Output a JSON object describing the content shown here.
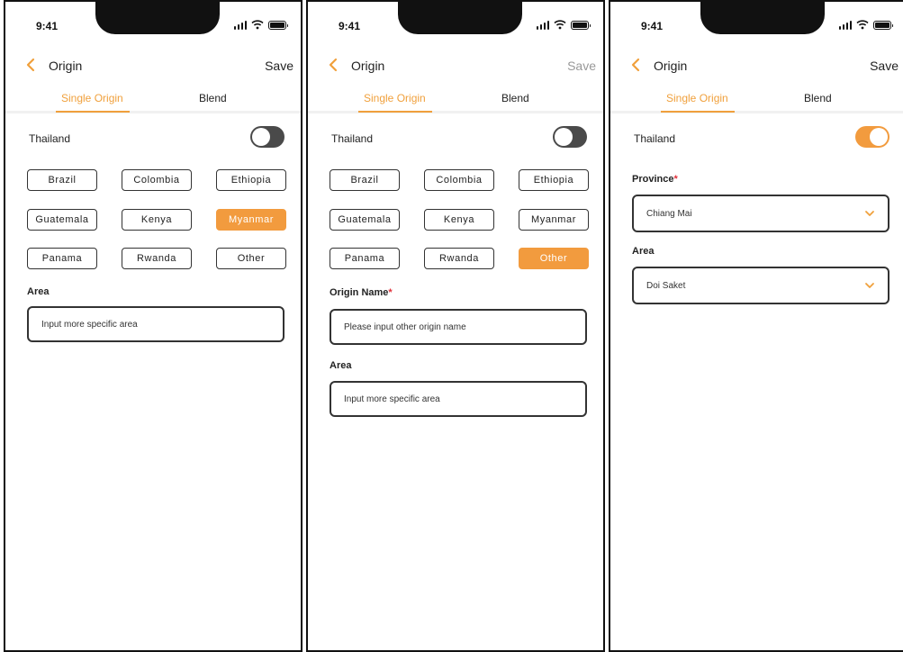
{
  "screens": [
    {
      "status": {
        "time": "9:41"
      },
      "header": {
        "title": "Origin",
        "save_label": "Save"
      },
      "tabs": [
        "Single Origin",
        "Blend"
      ],
      "country_toggle": {
        "label": "Thailand",
        "state": "off"
      },
      "chips": [
        {
          "label": "Brazil",
          "selected": false
        },
        {
          "label": "Colombia",
          "selected": false
        },
        {
          "label": "Ethiopia",
          "selected": false
        },
        {
          "label": "Guatemala",
          "selected": false
        },
        {
          "label": "Kenya",
          "selected": false
        },
        {
          "label": "Myanmar",
          "selected": true
        },
        {
          "label": "Panama",
          "selected": false
        },
        {
          "label": "Rwanda",
          "selected": false
        },
        {
          "label": "Other",
          "selected": false
        }
      ],
      "area": {
        "label": "Area",
        "placeholder": "Input more specific area"
      }
    },
    {
      "status": {
        "time": "9:41"
      },
      "header": {
        "title": "Origin",
        "save_label": "Save",
        "save_state": "disabled"
      },
      "tabs": [
        "Single Origin",
        "Blend"
      ],
      "country_toggle": {
        "label": "Thailand",
        "state": "off"
      },
      "chips": [
        {
          "label": "Brazil",
          "selected": false
        },
        {
          "label": "Colombia",
          "selected": false
        },
        {
          "label": "Ethiopia",
          "selected": false
        },
        {
          "label": "Guatemala",
          "selected": false
        },
        {
          "label": "Kenya",
          "selected": false
        },
        {
          "label": "Myanmar",
          "selected": false
        },
        {
          "label": "Panama",
          "selected": false
        },
        {
          "label": "Rwanda",
          "selected": false
        },
        {
          "label": "Other",
          "selected": true
        }
      ],
      "origin_name": {
        "label": "Origin Name",
        "required_mark": "*",
        "placeholder": "Please input other origin name"
      },
      "area": {
        "label": "Area",
        "placeholder": "Input more specific area"
      }
    },
    {
      "status": {
        "time": "9:41"
      },
      "header": {
        "title": "Origin",
        "save_label": "Save"
      },
      "tabs": [
        "Single Origin",
        "Blend"
      ],
      "country_toggle": {
        "label": "Thailand",
        "state": "on"
      },
      "province": {
        "label": "Province",
        "required_mark": "*",
        "value": "Chiang Mai"
      },
      "area": {
        "label": "Area",
        "value": "Doi Saket"
      }
    }
  ],
  "colors": {
    "accent": "#f29b3e",
    "tab_active": "#f0a03c",
    "required": "#e0303a",
    "toggle_off": "#4a4a4a"
  },
  "icons": {
    "back": "chevron-left-icon",
    "dropdown": "chevron-down-icon",
    "signal": "signal-icon",
    "wifi": "wifi-icon",
    "battery": "battery-icon"
  }
}
